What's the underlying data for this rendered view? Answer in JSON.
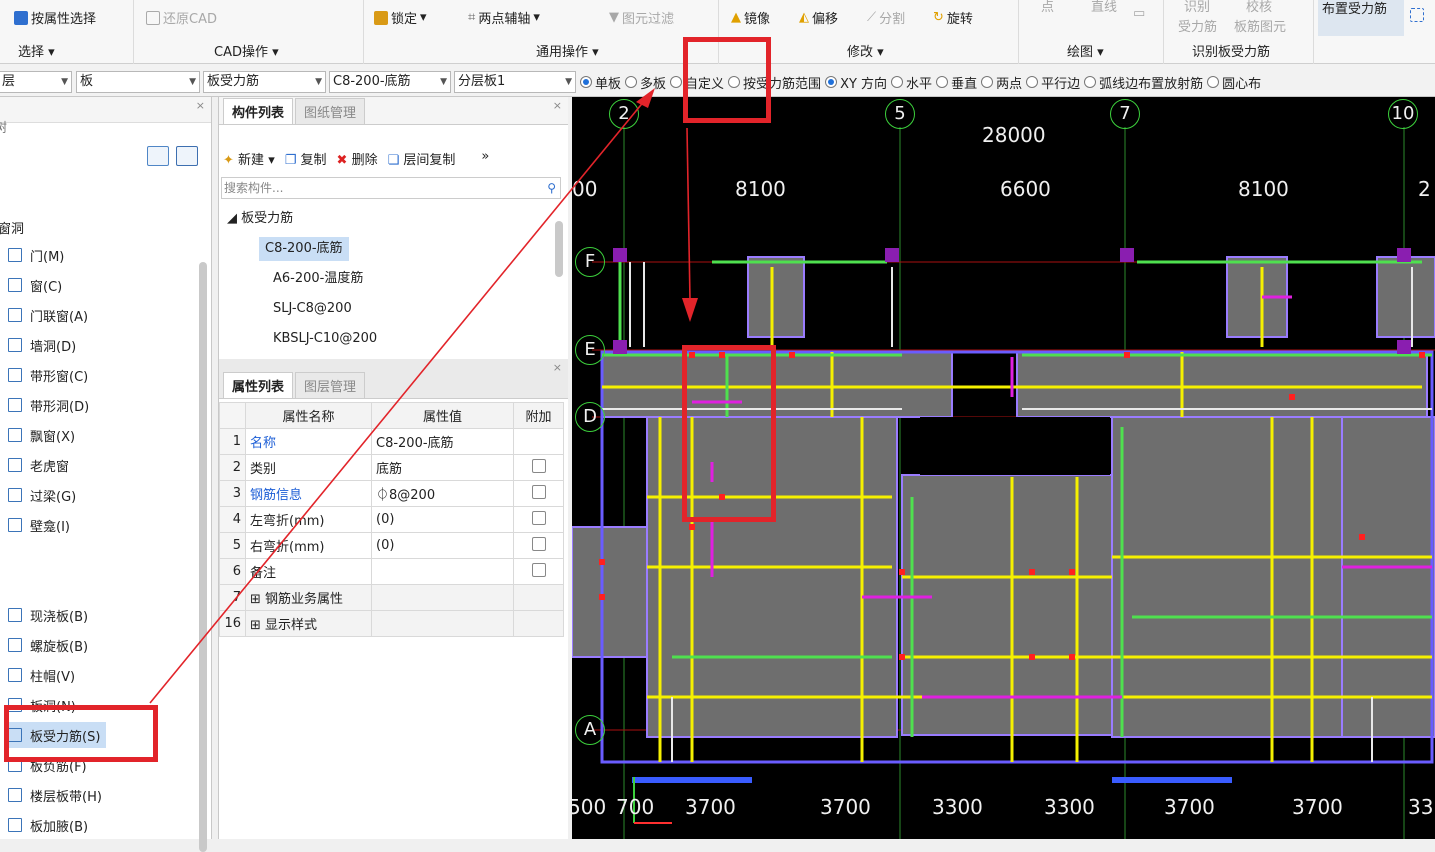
{
  "ribbon": {
    "select_group": {
      "button": "按属性选择",
      "label": "选择"
    },
    "cad_group": {
      "button": "还原CAD",
      "label": "CAD操作"
    },
    "common_group": {
      "lock": "锁定",
      "aux": "两点辅轴",
      "filter": "图元过滤",
      "label": "通用操作"
    },
    "modify_group": {
      "mirror": "镜像",
      "offset": "偏移",
      "split": "分割",
      "rotate": "旋转",
      "label": "修改"
    },
    "draw_group": {
      "point": "点",
      "line": "直线",
      "label": "绘图"
    },
    "identify_group": {
      "b1": "识别",
      "b2": "校核",
      "b3": "受力筋",
      "b4": "板筋图元",
      "label": "识别板受力筋"
    },
    "layout_group": {
      "button": "布置受力筋"
    }
  },
  "toolbar": {
    "combo1": "层",
    "combo2": "板",
    "combo3": "板受力筋",
    "combo4": "C8-200-底筋",
    "combo5": "分层板1",
    "radios": [
      {
        "label": "单板",
        "on": true
      },
      {
        "label": "多板",
        "on": false
      },
      {
        "label": "自定义",
        "on": false
      },
      {
        "label": "按受力筋范围",
        "on": false
      },
      {
        "label": "XY 方向",
        "on": true
      },
      {
        "label": "水平",
        "on": false
      },
      {
        "label": "垂直",
        "on": false
      },
      {
        "label": "两点",
        "on": false
      },
      {
        "label": "平行边",
        "on": false
      },
      {
        "label": "弧线边布置放射筋",
        "on": false
      },
      {
        "label": "圆心布",
        "on": false
      }
    ]
  },
  "left_panel": {
    "header": "树",
    "group": "窗洞",
    "items1": [
      "门(M)",
      "窗(C)",
      "门联窗(A)",
      "墙洞(D)",
      "带形窗(C)",
      "带形洞(D)",
      "飘窗(X)",
      "老虎窗",
      "过梁(G)",
      "壁龛(I)"
    ],
    "items2": [
      "现浇板(B)",
      "螺旋板(B)",
      "柱帽(V)",
      "板洞(N)",
      "板受力筋(S)",
      "板负筋(F)",
      "楼层板带(H)",
      "板加腋(B)"
    ]
  },
  "component_list": {
    "tab1": "构件列表",
    "tab2": "图纸管理",
    "new": "新建",
    "copy": "复制",
    "delete": "删除",
    "floor_copy": "层间复制",
    "search_placeholder": "搜索构件...",
    "root": "板受力筋",
    "items": [
      "C8-200-底筋",
      "A6-200-温度筋",
      "SLJ-C8@200",
      "KBSLJ-C10@200"
    ]
  },
  "property_list": {
    "tab1": "属性列表",
    "tab2": "图层管理",
    "headers": [
      "属性名称",
      "属性值",
      "附加"
    ],
    "rows": [
      {
        "n": "1",
        "name": "名称",
        "value": "C8-200-底筋",
        "blue": true,
        "chk": false
      },
      {
        "n": "2",
        "name": "类别",
        "value": "底筋",
        "blue": false,
        "chk": true
      },
      {
        "n": "3",
        "name": "钢筋信息",
        "value": "⏀8@200",
        "blue": true,
        "chk": true
      },
      {
        "n": "4",
        "name": "左弯折(mm)",
        "value": "(0)",
        "blue": false,
        "chk": true
      },
      {
        "n": "5",
        "name": "右弯折(mm)",
        "value": "(0)",
        "blue": false,
        "chk": true
      },
      {
        "n": "6",
        "name": "备注",
        "value": "",
        "blue": false,
        "chk": true
      },
      {
        "n": "7",
        "name": "钢筋业务属性",
        "value": "",
        "blue": false,
        "chk": false
      },
      {
        "n": "16",
        "name": "显示样式",
        "value": "",
        "blue": false,
        "chk": false
      }
    ]
  },
  "cad": {
    "top_axes": [
      "2",
      "5",
      "7",
      "10"
    ],
    "total_dim": "28000",
    "top_dims": [
      "00",
      "8100",
      "6600",
      "8100",
      "2"
    ],
    "left_axes": [
      "F",
      "E",
      "D",
      "A"
    ],
    "bottom_dims": [
      "500",
      "700",
      "3700",
      "3700",
      "3300",
      "3300",
      "3700",
      "3700",
      "33"
    ],
    "colors": {
      "background": "#000000",
      "slab": "#6e6e6e",
      "yellow": "#f5f000",
      "green": "#4fe04f",
      "magenta": "#e020e0",
      "red": "#ff2020"
    }
  }
}
